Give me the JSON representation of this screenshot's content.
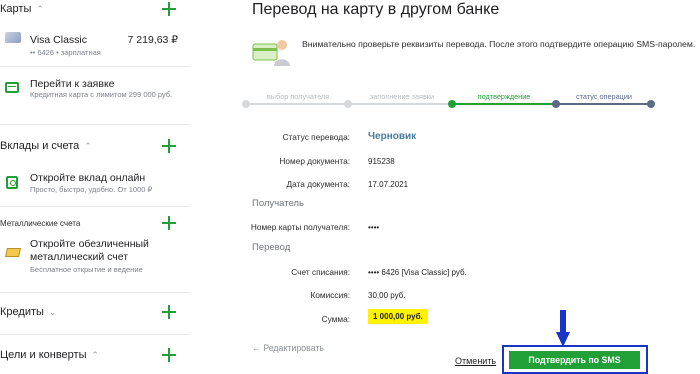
{
  "sidebar": {
    "cards_title": "Карты",
    "card": {
      "name": "Visa Classic",
      "meta": "•• 6426 • зарплатная",
      "amount": "7 219,63 ₽"
    },
    "apply": {
      "title": "Перейти к заявке",
      "sub": "Кредитная карта с лимитом 299 000 руб."
    },
    "deposits_title": "Вклады и счета",
    "deposit": {
      "title": "Откройте вклад онлайн",
      "sub": "Просто, быстро, удобно. От 1000 ₽"
    },
    "metals_title": "Металлические счета",
    "metal": {
      "title_1": "Откройте обезличенный",
      "title_2": "металлический счет",
      "sub": "Бесплатное открытие и ведение"
    },
    "credits_title": "Кредиты",
    "goals_title": "Цели и конверты"
  },
  "main": {
    "title": "Перевод на карту в другом банке",
    "notice": "Внимательно проверьте реквизиты перевода. После этого подтвердите операцию SMS-паролем.",
    "steps": [
      "выбор получателя",
      "заполнение заявки",
      "подтверждение",
      "статус операции"
    ],
    "rows": {
      "status": {
        "label": "Статус перевода:",
        "value": "Черновик"
      },
      "doc_num": {
        "label": "Номер документа:",
        "value": "915238"
      },
      "doc_date": {
        "label": "Дата документа:",
        "value": "17.07.2021"
      },
      "recipient_section": "Получатель",
      "card_num": {
        "label": "Номер карты получателя:",
        "value": "••••"
      },
      "transfer_section": "Перевод",
      "account": {
        "label": "Счет списания:",
        "value": "•••• 6426  [Visa Classic]  руб."
      },
      "fee": {
        "label": "Комиссия:",
        "value": "30,00 руб."
      },
      "sum": {
        "label": "Сумма:",
        "value": "1 000,00  руб."
      }
    },
    "edit_label": "← Редактировать",
    "cancel_label": "Отменить",
    "confirm_label": "Подтвердить по SMS"
  },
  "colors": {
    "accent": "#21a038",
    "link": "#437c9c",
    "highlight": "#fff203",
    "annotation": "#1935c7"
  }
}
